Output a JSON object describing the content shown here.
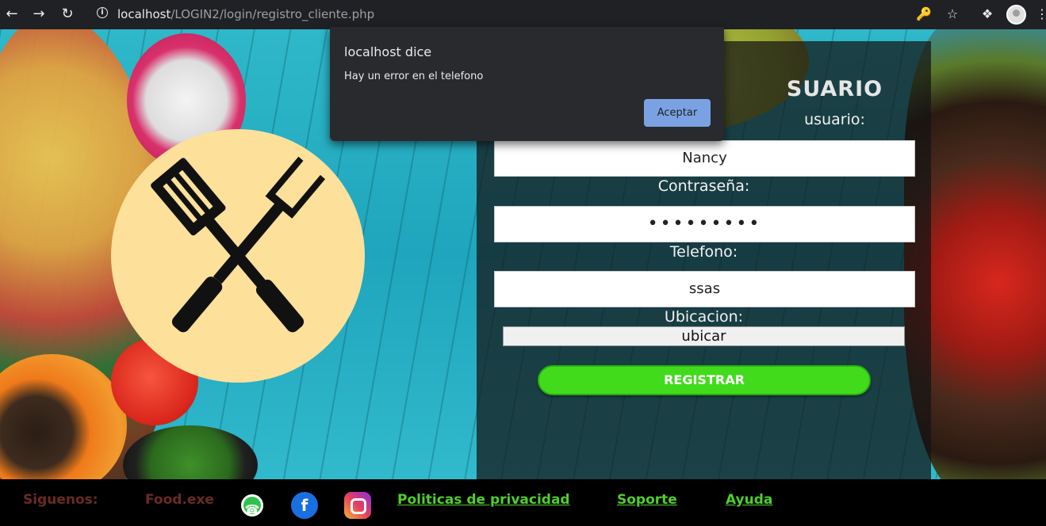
{
  "browser": {
    "url_host": "localhost",
    "url_path": "/LOGIN2/login/registro_cliente.php",
    "icons": [
      "back-arrow-icon",
      "forward-arrow-icon",
      "reload-icon",
      "info-icon",
      "key-icon",
      "star-icon",
      "puzzle-extension-icon",
      "profile-avatar-icon",
      "kebab-menu-icon"
    ]
  },
  "form": {
    "title": "SUARIO",
    "username_label": "usuario:",
    "username_value": "Nancy",
    "password_label": "Contraseña:",
    "password_value": "•••••••••",
    "phone_label": "Telefono:",
    "phone_value": "ssas",
    "location_label": "Ubicacion:",
    "locate_button": "ubicar",
    "register_button": "REGISTRAR"
  },
  "dialog": {
    "title": "localhost dice",
    "message": "Hay un error en el telefono",
    "accept_button": "Aceptar"
  },
  "footer": {
    "follow_label": "Siguenos:",
    "brand": "Food.exe",
    "privacy_link": "Politicas de privacidad",
    "support_link": "Soporte",
    "help_link": "Ayuda",
    "facebook_glyph": "f"
  },
  "colors": {
    "register_button": "#42db1c",
    "footer_link": "#4fcf2b",
    "footer_text": "#6b2a24",
    "dialog_button": "#7aa2e3",
    "logo_circle": "#fde09a"
  }
}
